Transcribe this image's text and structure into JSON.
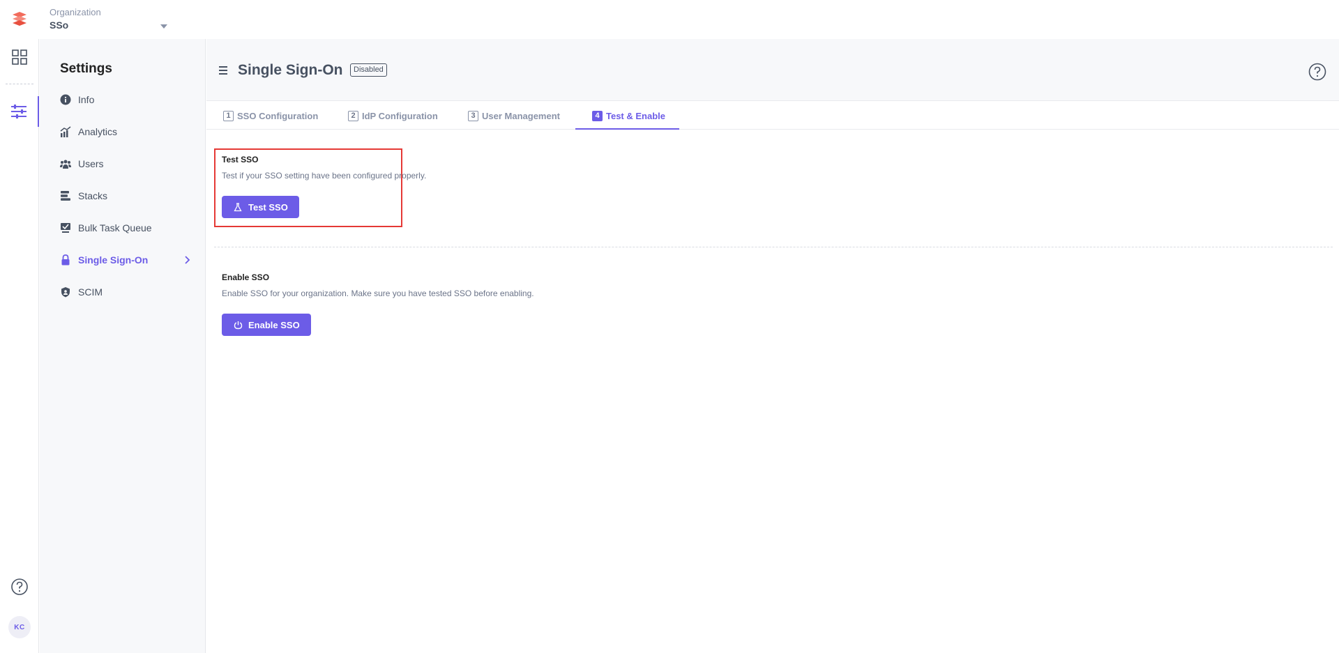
{
  "topbar": {
    "org_label": "Organization",
    "org_value": "SSo"
  },
  "rail": {
    "items": [
      {
        "name": "dashboard",
        "icon": "grid-icon"
      },
      {
        "name": "settings",
        "icon": "sliders-icon",
        "active": true
      }
    ],
    "help_icon": "help-circle-icon",
    "avatar_initials": "KC"
  },
  "sidebar": {
    "title": "Settings",
    "items": [
      {
        "label": "Info",
        "icon": "info-icon"
      },
      {
        "label": "Analytics",
        "icon": "analytics-icon"
      },
      {
        "label": "Users",
        "icon": "users-icon"
      },
      {
        "label": "Stacks",
        "icon": "stacks-icon"
      },
      {
        "label": "Bulk Task Queue",
        "icon": "task-queue-icon"
      },
      {
        "label": "Single Sign-On",
        "icon": "lock-icon",
        "active": true
      },
      {
        "label": "SCIM",
        "icon": "shield-icon"
      }
    ]
  },
  "header": {
    "title": "Single Sign-On",
    "status_badge": "Disabled"
  },
  "tabs": [
    {
      "num": "1",
      "label": "SSO Configuration"
    },
    {
      "num": "2",
      "label": "IdP Configuration"
    },
    {
      "num": "3",
      "label": "User Management"
    },
    {
      "num": "4",
      "label": "Test & Enable",
      "active": true
    }
  ],
  "test_section": {
    "title": "Test SSO",
    "description": "Test if your SSO setting have been configured properly.",
    "button_label": "Test SSO",
    "button_icon": "flask-icon"
  },
  "enable_section": {
    "title": "Enable SSO",
    "description": "Enable SSO for your organization. Make sure you have tested SSO before enabling.",
    "button_label": "Enable SSO",
    "button_icon": "power-icon"
  },
  "colors": {
    "accent": "#6c5ce7",
    "highlight_border": "#e53935",
    "text_muted": "#8a93a8",
    "text_dark": "#475161"
  }
}
